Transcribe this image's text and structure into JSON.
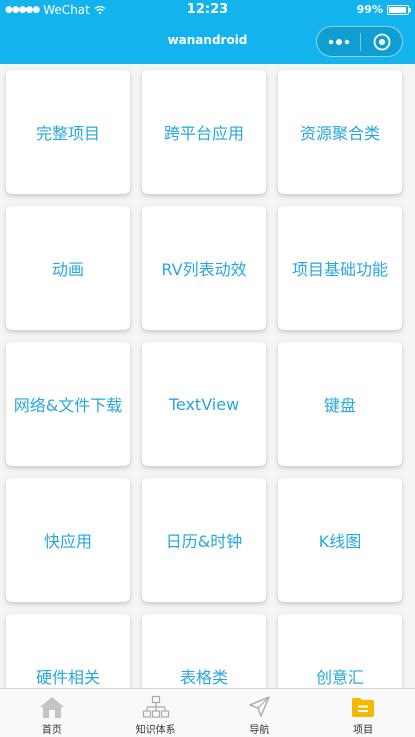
{
  "status_bar": {
    "signal": "●●●●●",
    "carrier": "WeChat",
    "time": "12:23",
    "battery": "99%"
  },
  "nav": {
    "title": "wanandroid"
  },
  "categories": [
    "完整项目",
    "跨平台应用",
    "资源聚合类",
    "动画",
    "RV列表动效",
    "项目基础功能",
    "网络&文件下载",
    "TextView",
    "键盘",
    "快应用",
    "日历&时钟",
    "K线图",
    "硬件相关",
    "表格类",
    "创意汇"
  ],
  "tabbar": {
    "items": [
      {
        "label": "首页",
        "icon": "home-icon"
      },
      {
        "label": "知识体系",
        "icon": "hierarchy-icon"
      },
      {
        "label": "导航",
        "icon": "navigation-icon"
      },
      {
        "label": "项目",
        "icon": "project-icon"
      }
    ],
    "active_index": 3
  },
  "colors": {
    "primary": "#13b3ee",
    "card_text": "#26a7df",
    "active_tab": "#f5b800"
  }
}
